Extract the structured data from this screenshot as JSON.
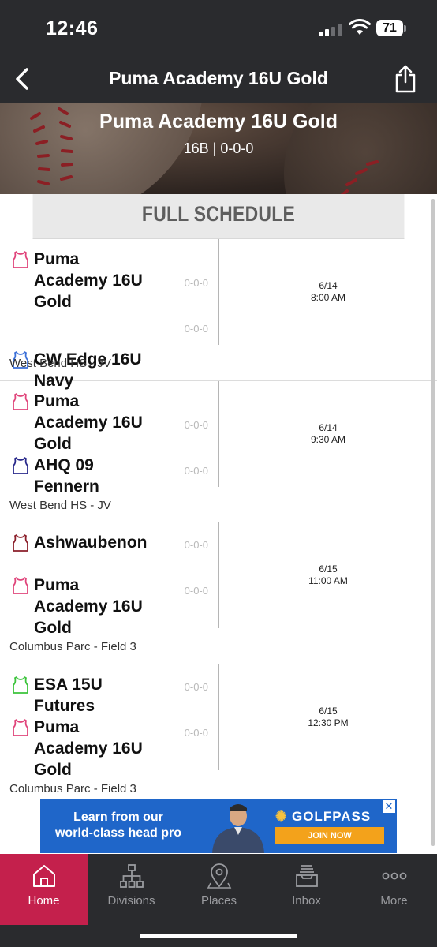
{
  "status_bar": {
    "time": "12:46",
    "battery": "71"
  },
  "nav": {
    "title": "Puma Academy 16U Gold",
    "back_icon": "chevron-left-icon",
    "share_icon": "share-icon"
  },
  "hero": {
    "title": "Puma Academy 16U Gold",
    "subtitle": "16B | 0-0-0"
  },
  "schedule": {
    "header": "FULL SCHEDULE",
    "games": [
      {
        "home": {
          "name": "Puma Academy 16U Gold",
          "record": "0-0-0",
          "color": "#e0457b"
        },
        "away": {
          "name": "CW Edge 16U Navy",
          "record": "0-0-0",
          "color": "#3a6fd8"
        },
        "date": "6/14",
        "time": "8:00 AM",
        "venue": "West Bend HS - JV"
      },
      {
        "home": {
          "name": "Puma Academy 16U Gold",
          "record": "0-0-0",
          "color": "#e0457b"
        },
        "away": {
          "name": "AHQ 09 Fennern",
          "record": "0-0-0",
          "color": "#2a2a8c"
        },
        "date": "6/14",
        "time": "9:30 AM",
        "venue": "West Bend HS - JV"
      },
      {
        "home": {
          "name": "Ashwaubenon",
          "record": "0-0-0",
          "color": "#8b1f2a"
        },
        "away": {
          "name": "Puma Academy 16U Gold",
          "record": "0-0-0",
          "color": "#e0457b"
        },
        "date": "6/15",
        "time": "11:00 AM",
        "venue": "Columbus Parc - Field 3"
      },
      {
        "home": {
          "name": "ESA 15U Futures",
          "record": "0-0-0",
          "color": "#3cc43c"
        },
        "away": {
          "name": "Puma Academy 16U Gold",
          "record": "0-0-0",
          "color": "#e0457b"
        },
        "date": "6/15",
        "time": "12:30 PM",
        "venue": "Columbus Parc - Field 3"
      }
    ]
  },
  "ad": {
    "line1": "Learn from our",
    "line2": "world-class head pro",
    "brand": "GOLFPASS",
    "cta": "JOIN NOW"
  },
  "tabs": [
    {
      "label": "Home",
      "icon": "home-icon",
      "active": true
    },
    {
      "label": "Divisions",
      "icon": "bracket-icon",
      "active": false
    },
    {
      "label": "Places",
      "icon": "map-pin-icon",
      "active": false
    },
    {
      "label": "Inbox",
      "icon": "inbox-icon",
      "active": false
    },
    {
      "label": "More",
      "icon": "more-dots-icon",
      "active": false
    }
  ]
}
